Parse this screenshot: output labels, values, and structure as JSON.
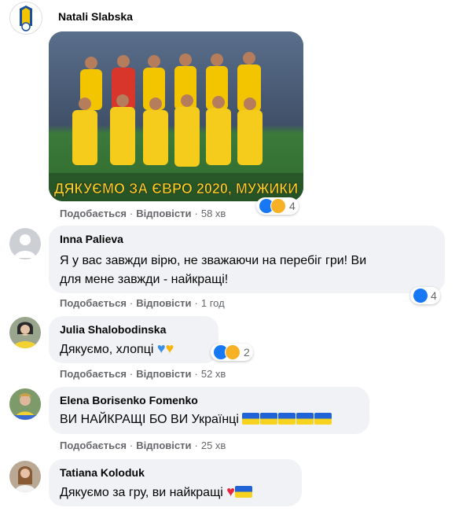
{
  "comments": [
    {
      "name": "Natali Slabska",
      "image_caption": "ДЯКУЄМО ЗА ЄВРО 2020, МУЖИКИ",
      "like": "Подобається",
      "reply": "Відповісти",
      "time": "58 хв",
      "reactions": "4"
    },
    {
      "name": "Inna Palieva",
      "line1": "Я у вас завжди вірю, не зважаючи на перебіг гри! Ви",
      "line2": "для мене завжди - найкращі!",
      "like": "Подобається",
      "reply": "Відповісти",
      "time": "1 год",
      "reactions": "4"
    },
    {
      "name": "Julia Shalobodinska",
      "text": "Дякуємо, хлопці",
      "like": "Подобається",
      "reply": "Відповісти",
      "time": "52 хв",
      "reactions": "2"
    },
    {
      "name": "Elena Borisenko Fomenko",
      "text": "ВИ НАЙКРАЩІ БО ВИ Українці",
      "like": "Подобається",
      "reply": "Відповісти",
      "time": "25 хв"
    },
    {
      "name": "Tatiana Koloduk",
      "text": "Дякуємо за гру, ви найкращі"
    }
  ],
  "separator": "·"
}
